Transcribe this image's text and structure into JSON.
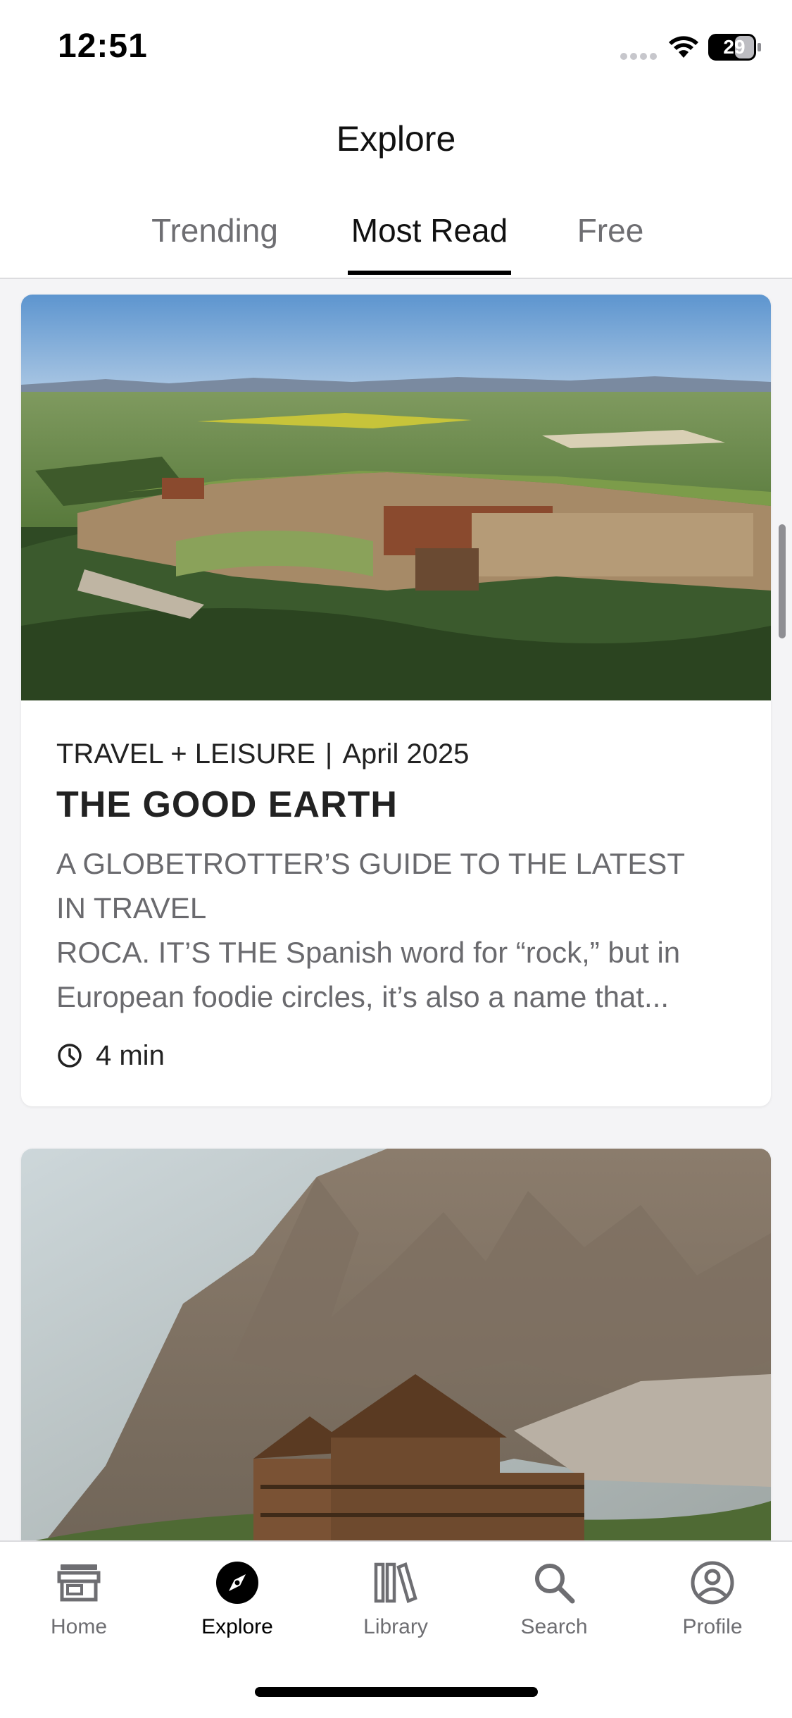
{
  "status_bar": {
    "time": "12:51",
    "battery_level": "29",
    "icons": [
      "signal-dots-icon",
      "wifi-icon",
      "battery-icon"
    ]
  },
  "header": {
    "title": "Explore",
    "tabs": [
      {
        "label": "Trending",
        "active": false
      },
      {
        "label": "Most Read",
        "active": true
      },
      {
        "label": "Free",
        "active": false
      }
    ]
  },
  "feed": {
    "articles": [
      {
        "publication": "TRAVEL + LEISURE",
        "separator": "|",
        "date": "April 2025",
        "title": "THE GOOD EARTH",
        "excerpt_lines": [
          "A GLOBETROTTER’S GUIDE TO THE LATEST",
          "IN TRAVEL",
          "ROCA. IT’S THE Spanish word for “rock,” but in",
          "European foodie circles, it’s also a name that..."
        ],
        "read_time": "4 min",
        "image": "aerial-fortress-hotel-photo"
      },
      {
        "image": "mountain-chalet-photo"
      }
    ]
  },
  "tab_bar": {
    "items": [
      {
        "label": "Home",
        "icon": "storefront-icon",
        "active": false
      },
      {
        "label": "Explore",
        "icon": "compass-icon",
        "active": true
      },
      {
        "label": "Library",
        "icon": "library-books-icon",
        "active": false
      },
      {
        "label": "Search",
        "icon": "search-icon",
        "active": false
      },
      {
        "label": "Profile",
        "icon": "profile-icon",
        "active": false
      }
    ]
  },
  "colors": {
    "accent": "#000000",
    "inactive": "#6e6e72",
    "background": "#f4f4f6",
    "card": "#ffffff"
  }
}
